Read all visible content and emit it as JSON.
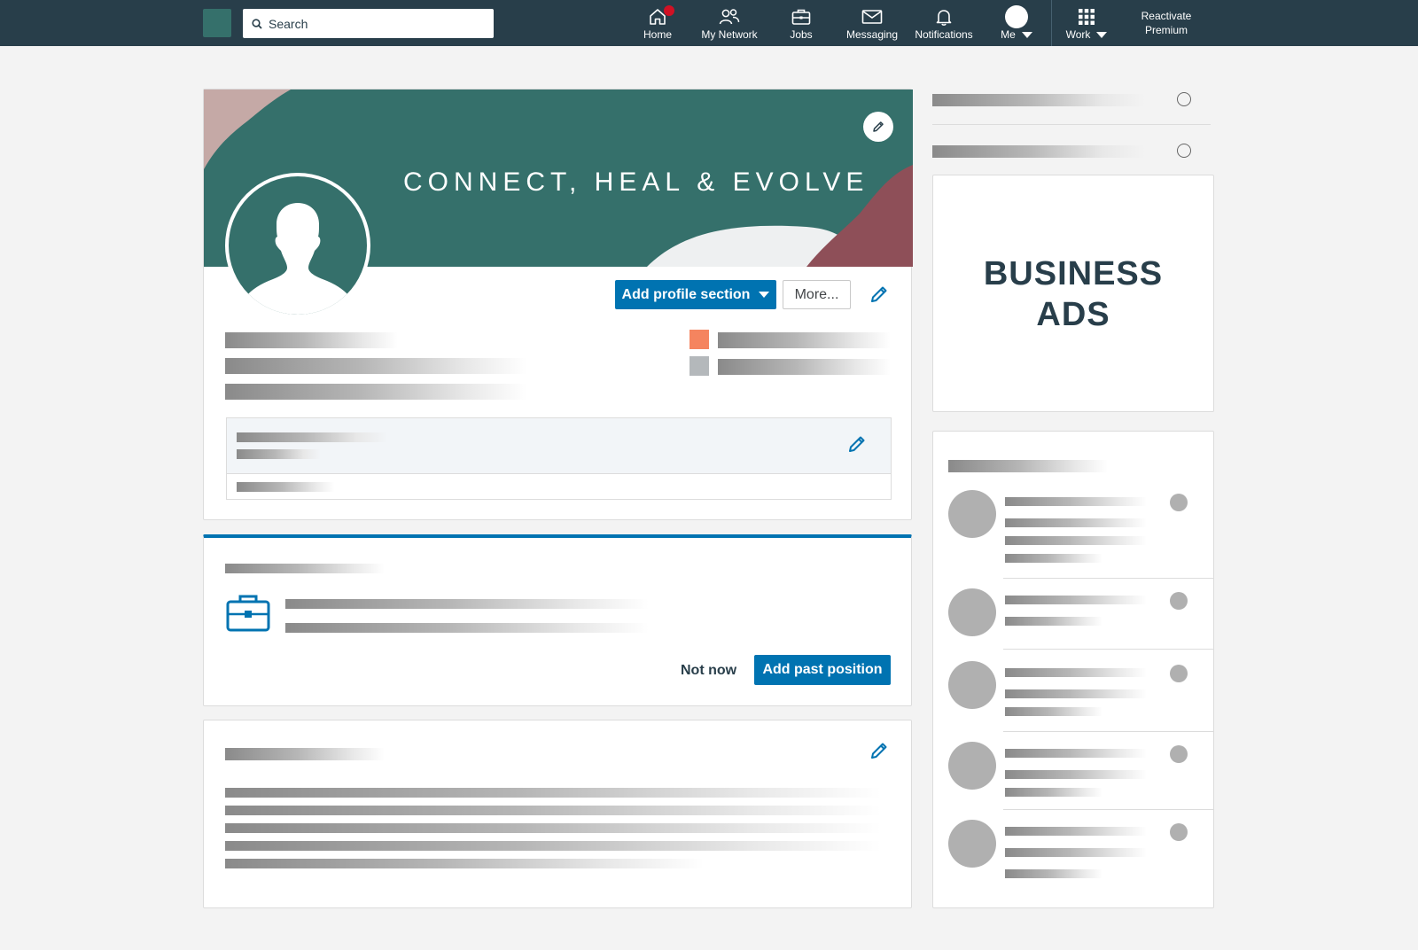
{
  "nav": {
    "search_placeholder": "Search",
    "items": [
      {
        "label": "Home",
        "icon": "home-icon"
      },
      {
        "label": "My Network",
        "icon": "people-icon"
      },
      {
        "label": "Jobs",
        "icon": "briefcase-icon"
      },
      {
        "label": "Messaging",
        "icon": "envelope-icon"
      },
      {
        "label": "Notifications",
        "icon": "bell-icon"
      },
      {
        "label": "Me",
        "icon": "avatar"
      },
      {
        "label": "Work",
        "icon": "grid-icon"
      }
    ],
    "premium_line1": "Reactivate",
    "premium_line2": "Premium"
  },
  "profile": {
    "banner_text": "CONNECT, HEAL & EVOLVE",
    "add_section_label": "Add profile section",
    "more_label": "More..."
  },
  "experience_prompt": {
    "not_now_label": "Not now",
    "add_position_label": "Add past position"
  },
  "ad": {
    "line1": "BUSINESS",
    "line2": "ADS"
  },
  "colors": {
    "nav_bg": "#283e4a",
    "brand_teal": "#35706b",
    "primary_blue": "#0073b1",
    "accent_orange": "#f5845f",
    "notification_red": "#d11124"
  }
}
